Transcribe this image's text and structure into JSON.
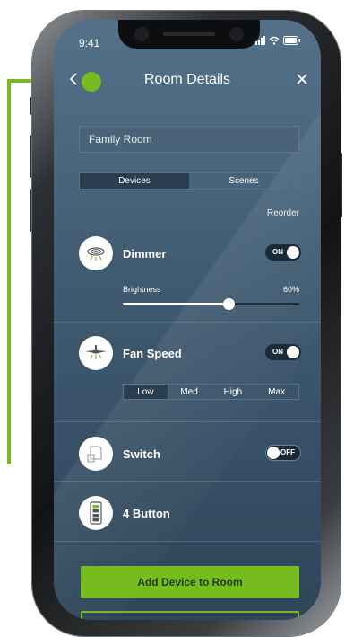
{
  "status_bar": {
    "time": "9:41"
  },
  "header": {
    "title": "Room Details",
    "back_icon": "chevron-left-icon",
    "close_icon": "close-icon"
  },
  "room_name": {
    "value": "Family Room"
  },
  "tabs": [
    {
      "label": "Devices",
      "active": true
    },
    {
      "label": "Scenes",
      "active": false
    }
  ],
  "reorder_label": "Reorder",
  "devices": [
    {
      "name": "Dimmer",
      "icon": "ceiling-light-icon",
      "toggle": "ON",
      "on": true
    },
    {
      "name": "Fan Speed",
      "icon": "ceiling-fan-icon",
      "toggle": "ON",
      "on": true
    },
    {
      "name": "Switch",
      "icon": "light-switch-icon",
      "toggle": "OFF",
      "on": false
    },
    {
      "name": "4 Button",
      "icon": "keypad-icon"
    }
  ],
  "brightness": {
    "label": "Brightness",
    "value": "60%",
    "level": 0.6
  },
  "fan_speeds": [
    {
      "label": "Low",
      "active": true
    },
    {
      "label": "Med",
      "active": false
    },
    {
      "label": "High",
      "active": false
    },
    {
      "label": "Max",
      "active": false
    }
  ],
  "add_button_label": "Add Device to Room",
  "colors": {
    "accent": "#76bc21",
    "screen_bg": "#3f5a70",
    "segment_active": "#2a3e50"
  }
}
